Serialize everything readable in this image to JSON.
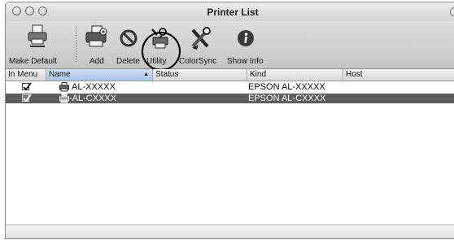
{
  "window": {
    "title": "Printer List"
  },
  "toolbar": {
    "make_default": "Make Default",
    "add": "Add",
    "delete": "Delete",
    "utility": "Utility",
    "colorsync": "ColorSync",
    "show_info": "Show Info"
  },
  "columns": {
    "in_menu": "In Menu",
    "name": "Name",
    "status": "Status",
    "kind": "Kind",
    "host": "Host",
    "sort_indicator": "▲"
  },
  "printers": [
    {
      "in_menu": true,
      "name": "AL-XXXXX",
      "status": "",
      "kind": "EPSON AL-XXXXX",
      "host": "",
      "selected": false
    },
    {
      "in_menu": true,
      "name": "AL-CXXXX",
      "status": "",
      "kind": "EPSON AL-CXXXX",
      "host": "",
      "selected": true
    }
  ],
  "colors": {
    "selection": "#5d5d5d",
    "sorted_header": "#a9c3e6"
  },
  "icons": [
    "printer-default-icon",
    "printer-add-icon",
    "delete-icon",
    "utility-icon",
    "colorsync-icon",
    "info-icon",
    "printer-icon"
  ]
}
